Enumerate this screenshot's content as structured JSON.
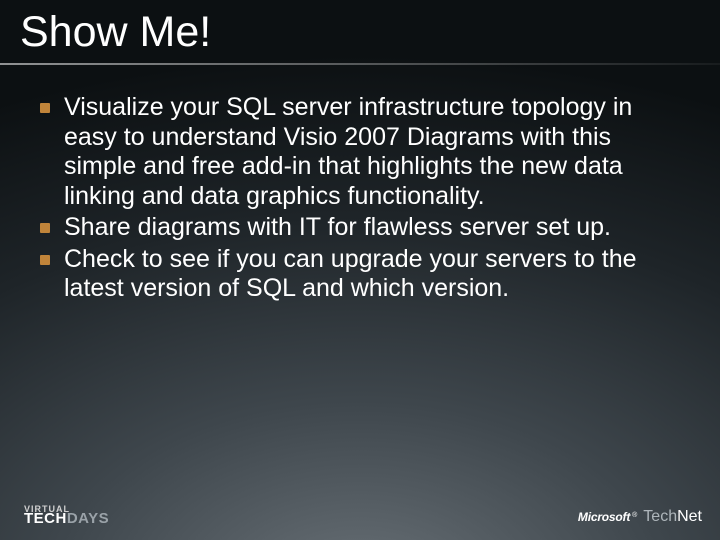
{
  "title": "Show Me!",
  "bullets": [
    "Visualize your SQL server infrastructure topology in easy to understand Visio 2007 Diagrams with this simple and free add-in that highlights the new data linking and data graphics functionality.",
    "Share diagrams with IT for flawless server set up.",
    "Check to see if you can upgrade your servers to the latest version of SQL and which version."
  ],
  "footer": {
    "left": {
      "line1": "VIRTUAL",
      "line2a": "TECH",
      "line2b": "DAYS"
    },
    "right": {
      "brand": "Microsoft",
      "reg": "®",
      "product_a": "Tech",
      "product_b": "Net"
    }
  }
}
